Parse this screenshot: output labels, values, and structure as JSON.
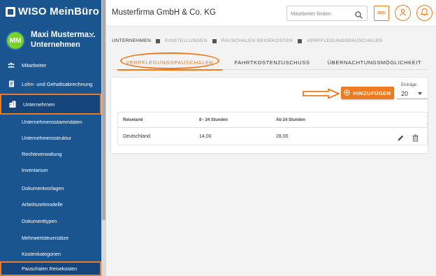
{
  "sidebar": {
    "logo": "WISO MeinBüro",
    "user": {
      "initials": "MM",
      "name": "Maxi Musterma...",
      "company": "Unternehmen"
    },
    "items": [
      {
        "label": "Mitarbeiter",
        "icon": "people-icon"
      },
      {
        "label": "Lohn- und Gehaltsabrechnung",
        "icon": "payroll-icon"
      },
      {
        "label": "Unternehmen",
        "icon": "building-icon"
      }
    ],
    "subitems": [
      "Unternehmensstammdaten",
      "Unternehmensstruktur",
      "Rechteverwaltung",
      "Inventarium",
      "Dokumentvorlagen",
      "Arbeitszeitmodelle",
      "Dokumenttypen",
      "Mehrwertsteuersätze",
      "Kostenkategorien",
      "Pauschalen Reisekosten"
    ]
  },
  "header": {
    "company": "Musterfirma GmbH & Co. KG",
    "search_placeholder": "Mitarbeiter finden",
    "language": "DEU"
  },
  "breadcrumb": [
    "UNTERNEHMEN",
    "EINSTELLUNGEN",
    "PAUSCHALEN REISEKOSTEN",
    "VERPFLEGUNGSPAUSCHALEN"
  ],
  "tabs": [
    "VERPFLEGUNGSPAUSCHALEN",
    "FAHRTKOSTENZUSCHUSS",
    "ÜBERNACHTUNGSMÖGLICHKEIT"
  ],
  "toolbar": {
    "add_label": "HINZUFÜGEN",
    "entries_label": "Einträge",
    "entries_value": "20"
  },
  "table": {
    "headers": [
      "Reiseland",
      "8 - 24 Stunden",
      "Ab 24 Stunden"
    ],
    "rows": [
      {
        "country": "Deutschland",
        "rate_8_24": "14,00",
        "rate_24": "28,00"
      }
    ]
  },
  "colors": {
    "accent": "#ee7b1f",
    "sidebar": "#1b5590"
  }
}
